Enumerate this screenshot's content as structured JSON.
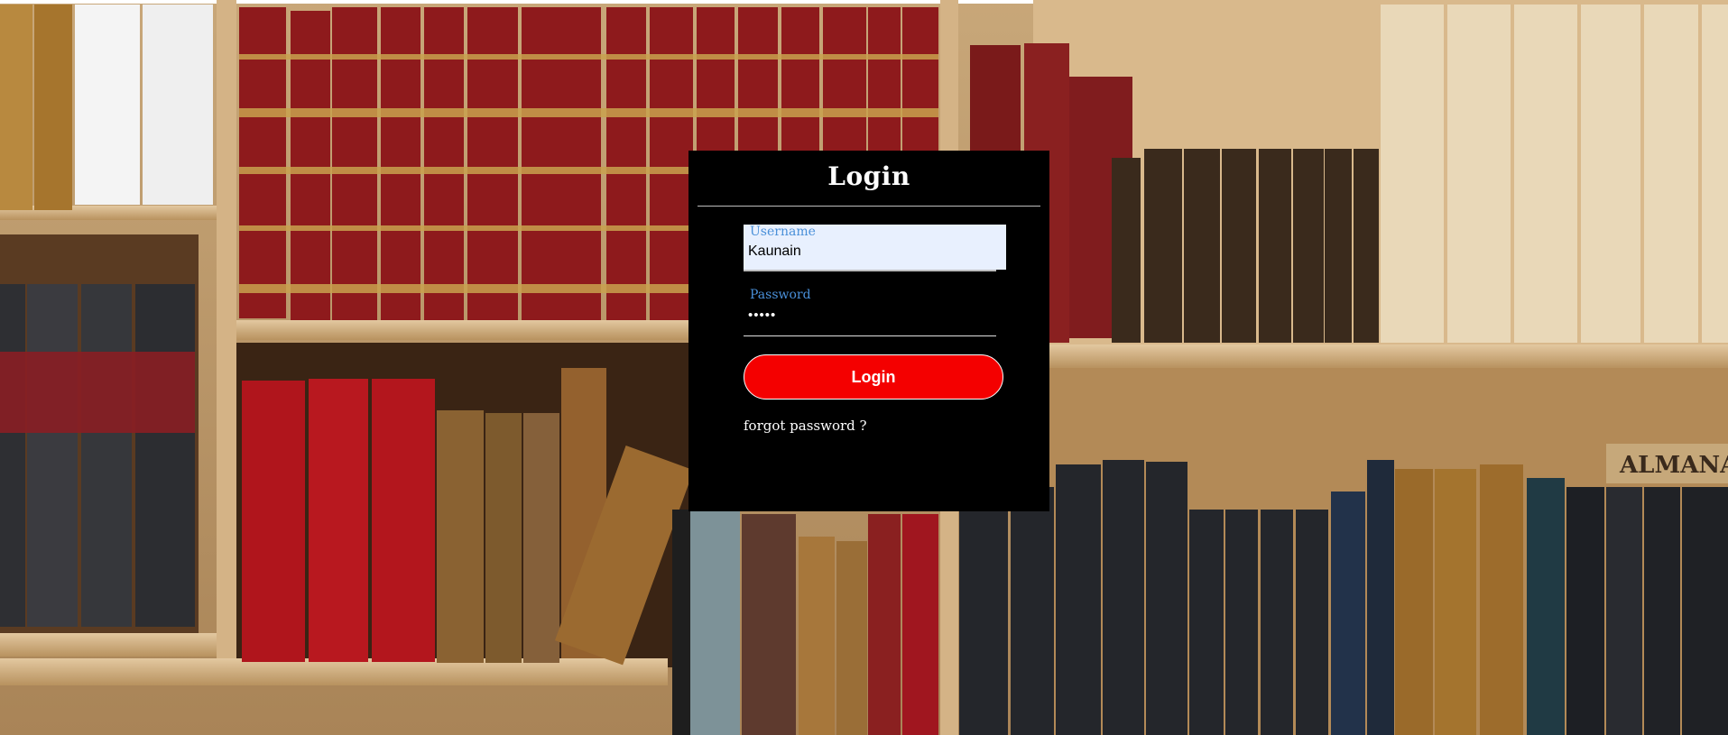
{
  "page": {
    "background": "bookshelf-photo"
  },
  "login": {
    "title": "Login",
    "username": {
      "label": "Username",
      "value": "Kaunain"
    },
    "password": {
      "label": "Password",
      "value": "•••••"
    },
    "submit_label": "Login",
    "forgot_label": "forgot password ?"
  },
  "background_art": {
    "almanac_label": "ALMANACH"
  },
  "colors": {
    "card_bg": "#000000",
    "label_blue": "#4a90d9",
    "button_red": "#f40000",
    "autofill_bg": "#e8f0fe"
  }
}
